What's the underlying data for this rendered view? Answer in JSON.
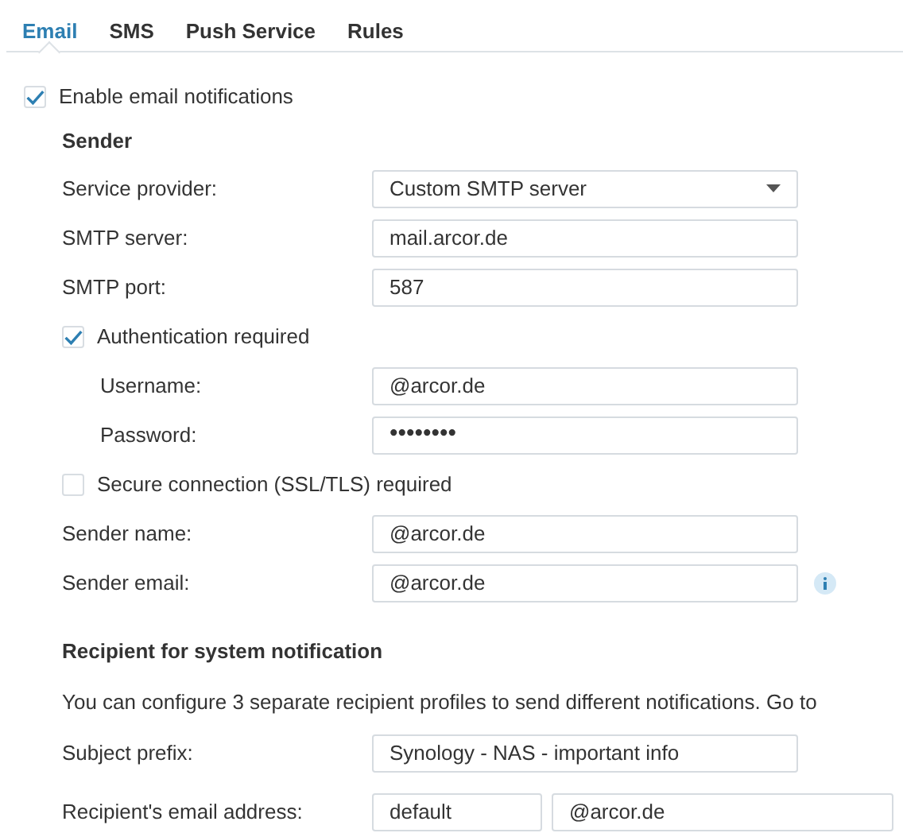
{
  "tabs": [
    {
      "label": "Email",
      "selected": true
    },
    {
      "label": "SMS",
      "selected": false
    },
    {
      "label": "Push Service",
      "selected": false
    },
    {
      "label": "Rules",
      "selected": false
    }
  ],
  "enable": {
    "label": "Enable email notifications",
    "checked": true
  },
  "sender": {
    "heading": "Sender",
    "rows": [
      {
        "kind": "select",
        "label": "Service provider:",
        "value": "Custom SMTP server"
      },
      {
        "kind": "input",
        "label": "SMTP server:",
        "value": "mail.arcor.de"
      },
      {
        "kind": "input",
        "label": "SMTP port:",
        "value": "587"
      },
      {
        "kind": "checkbox",
        "label": "Authentication required",
        "checked": true,
        "children": [
          {
            "kind": "input",
            "label": "Username:",
            "value": "@arcor.de"
          },
          {
            "kind": "password",
            "label": "Password:",
            "value": "••••••••"
          }
        ]
      },
      {
        "kind": "checkbox",
        "label": "Secure connection (SSL/TLS) required",
        "checked": false
      },
      {
        "kind": "input",
        "label": "Sender name:",
        "value": "@arcor.de"
      },
      {
        "kind": "input",
        "label": "Sender email:",
        "value": "@arcor.de",
        "info": true
      }
    ]
  },
  "recipient": {
    "heading": "Recipient for system notification",
    "note": "You can configure 3 separate recipient profiles to send different notifications. Go to",
    "subject": {
      "label": "Subject prefix:",
      "value": "Synology - NAS - important info"
    },
    "address": {
      "label": "Recipient's email address:",
      "profile": "default",
      "value": "@arcor.de"
    }
  }
}
